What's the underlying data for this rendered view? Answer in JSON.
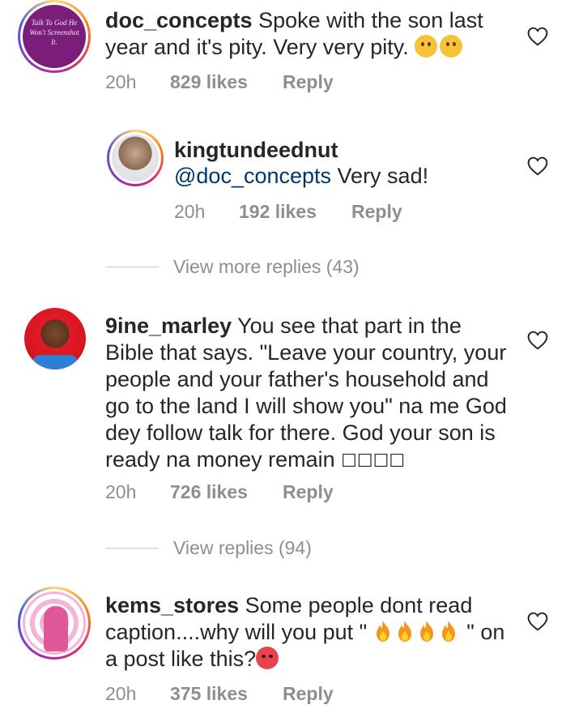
{
  "comments": [
    {
      "username": "doc_concepts",
      "text": " Spoke with the son last year and it's pity. Very very pity. ",
      "emoji": [
        "crying-face",
        "sad-face"
      ],
      "time": "20h",
      "likes": "829 likes",
      "reply": "Reply",
      "avatar_text": "Talk To God He Won't Screenshot It."
    },
    {
      "username": "kingtundeednut",
      "mention": "@doc_concepts",
      "text": " Very sad!",
      "time": "20h",
      "likes": "192 likes",
      "reply": "Reply"
    },
    {
      "username": "9ine_marley",
      "text": " You see that part in the Bible that says. \"Leave your country, your people and your father's household and go to the land I will show you\" na me God dey follow talk for there. God your son is ready na money remain ",
      "trailing_glyphs": "☐☐☐☐",
      "time": "20h",
      "likes": "726 likes",
      "reply": "Reply"
    },
    {
      "username": "kems_stores",
      "text_before": " Some people dont read caption....why will you put \" ",
      "text_after": " \" on a post like this?",
      "emoji": [
        "fire",
        "fire",
        "fire",
        "fire",
        "angry-face"
      ],
      "time": "20h",
      "likes": "375 likes",
      "reply": "Reply"
    }
  ],
  "view_more_replies": "View more replies (43)",
  "view_replies": "View replies (94)",
  "colors": {
    "text": "#262626",
    "muted": "#8e8e8e",
    "mention": "#00376b",
    "avatar_ring": "#d62976"
  }
}
